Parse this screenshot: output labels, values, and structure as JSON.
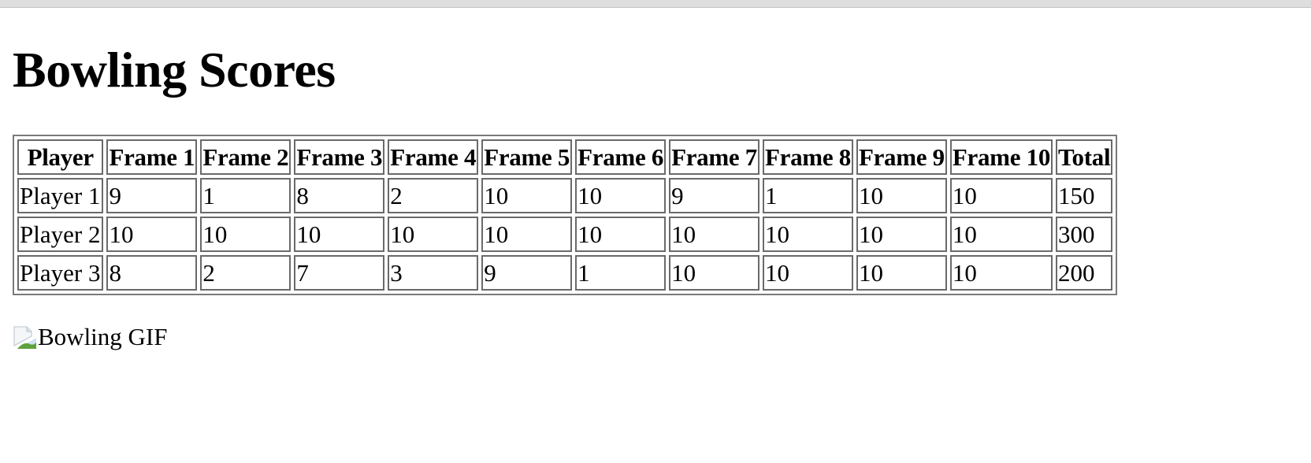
{
  "page": {
    "title": "Bowling Scores",
    "image_alt": "Bowling GIF"
  },
  "table": {
    "headers": [
      "Player",
      "Frame 1",
      "Frame 2",
      "Frame 3",
      "Frame 4",
      "Frame 5",
      "Frame 6",
      "Frame 7",
      "Frame 8",
      "Frame 9",
      "Frame 10",
      "Total"
    ],
    "rows": [
      [
        "Player 1",
        "9",
        "1",
        "8",
        "2",
        "10",
        "10",
        "9",
        "1",
        "10",
        "10",
        "150"
      ],
      [
        "Player 2",
        "10",
        "10",
        "10",
        "10",
        "10",
        "10",
        "10",
        "10",
        "10",
        "10",
        "300"
      ],
      [
        "Player 3",
        "8",
        "2",
        "7",
        "3",
        "9",
        "1",
        "10",
        "10",
        "10",
        "10",
        "200"
      ]
    ]
  },
  "icons": {
    "broken_image": "broken-image-icon"
  },
  "colors": {
    "background": "#ffffff",
    "text": "#000000",
    "cell_border": "#6a6a6a",
    "table_border": "#7a7a7a",
    "topbar": "#dedede"
  }
}
